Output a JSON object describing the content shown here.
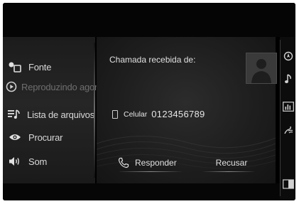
{
  "menu": {
    "items": [
      {
        "label": "Fonte",
        "icon": "source-icon",
        "enabled": true
      },
      {
        "label": "Reproduzindo agora",
        "icon": "play-circle-icon",
        "enabled": false
      },
      {
        "label": "Lista de arquivos",
        "icon": "playlist-icon",
        "enabled": true
      },
      {
        "label": "Procurar",
        "icon": "eye-icon",
        "enabled": true
      },
      {
        "label": "Som",
        "icon": "speaker-icon",
        "enabled": true
      }
    ]
  },
  "call": {
    "title": "Chamada recebida de:",
    "caller_type": "Celular",
    "number": "0123456789",
    "answer_label": "Responder",
    "decline_label": "Recusar"
  },
  "sidebar": {
    "icons": [
      "navigation-icon",
      "music-note-icon",
      "equalizer-icon",
      "climate-icon",
      "screen-toggle-icon"
    ]
  },
  "colors": {
    "background": "#000000",
    "panel": "#222222",
    "text": "#d8d8d8",
    "disabled_text": "#6e6e6e"
  }
}
